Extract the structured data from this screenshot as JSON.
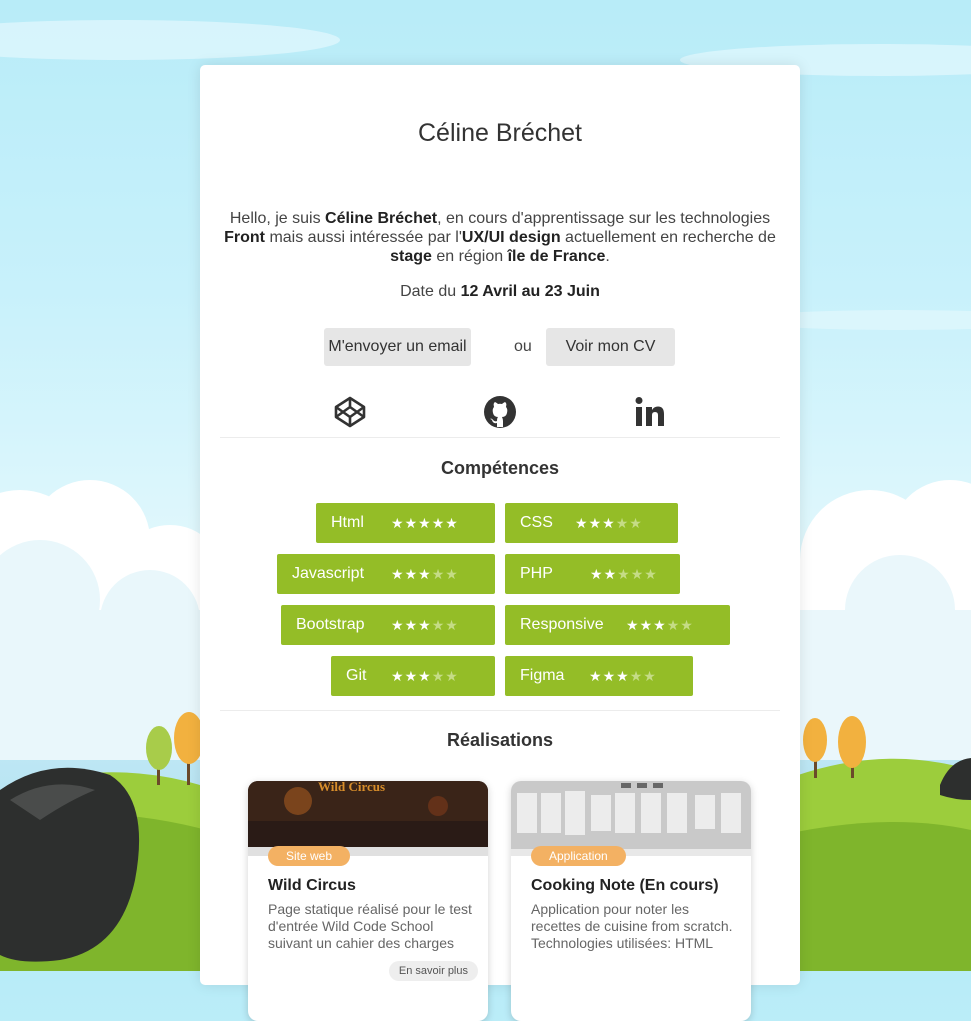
{
  "profile": {
    "name": "Céline Bréchet",
    "intro": {
      "p1": "Hello, je suis ",
      "name": "Céline Bréchet",
      "p2": ", en cours d'apprentissage sur les technologies ",
      "front": "Front",
      "p3": " mais aussi intéressée par l'",
      "uxui": "UX/UI design",
      "p4": " actuellement en recherche de ",
      "stage": "stage",
      "p5": " en région ",
      "region": "île de France",
      "p6": "."
    },
    "date": {
      "prefix": "Date du ",
      "range": "12 Avril au 23 Juin"
    }
  },
  "actions": {
    "email_label": "M'envoyer un email",
    "or_label": "ou",
    "cv_label": "Voir mon CV"
  },
  "social": [
    "codepen-icon",
    "github-icon",
    "linkedin-icon"
  ],
  "skills_title": "Compétences",
  "skills": [
    {
      "label": "Html",
      "rating": 5
    },
    {
      "label": "CSS",
      "rating": 3
    },
    {
      "label": "Javascript",
      "rating": 3
    },
    {
      "label": "PHP",
      "rating": 2
    },
    {
      "label": "Bootstrap",
      "rating": 3
    },
    {
      "label": "Responsive",
      "rating": 3
    },
    {
      "label": "Git",
      "rating": 3
    },
    {
      "label": "Figma",
      "rating": 3
    }
  ],
  "projects_title": "Réalisations",
  "projects": [
    {
      "badge": "Site web",
      "title": "Wild Circus",
      "desc": "Page statique réalisé pour le test d'entrée Wild Code School suivant un cahier des charges",
      "thumb_text": "Wild Circus",
      "more": "En savoir plus"
    },
    {
      "badge": "Application",
      "title": "Cooking Note (En cours)",
      "desc": "Application pour noter les recettes de cuisine from scratch.\nTechnologies utilisées: HTML"
    }
  ],
  "colors": {
    "skill_green": "#94bd27",
    "badge_orange": "#f3b163",
    "button_gray": "#e6e6e6"
  }
}
